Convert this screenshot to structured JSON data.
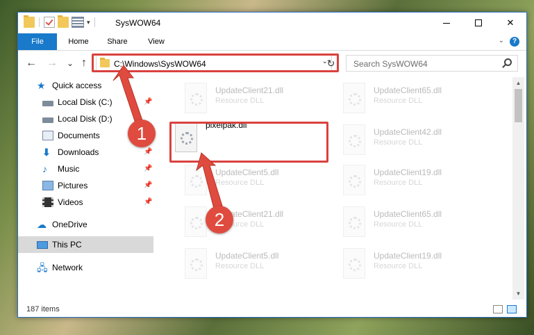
{
  "window": {
    "title": "SysWOW64"
  },
  "ribbon": {
    "tabs": [
      "File",
      "Home",
      "Share",
      "View"
    ],
    "help": "?"
  },
  "nav": {
    "back": "←",
    "forward": "→",
    "recent": "⌄",
    "up": "↑",
    "address": "C:\\Windows\\SysWOW64",
    "refresh": "↻",
    "search_placeholder": "Search SysWOW64"
  },
  "sidebar": {
    "items": [
      {
        "label": "Quick access",
        "icon": "star-icon",
        "pinned": false
      },
      {
        "label": "Local Disk (C:)",
        "icon": "disk-icon",
        "pinned": true
      },
      {
        "label": "Local Disk (D:)",
        "icon": "disk-icon",
        "pinned": false
      },
      {
        "label": "Documents",
        "icon": "documents-icon",
        "pinned": true
      },
      {
        "label": "Downloads",
        "icon": "downloads-icon",
        "pinned": true
      },
      {
        "label": "Music",
        "icon": "music-icon",
        "pinned": true
      },
      {
        "label": "Pictures",
        "icon": "pictures-icon",
        "pinned": true
      },
      {
        "label": "Videos",
        "icon": "videos-icon",
        "pinned": true
      },
      {
        "label": "OneDrive",
        "icon": "cloud-icon",
        "pinned": false
      },
      {
        "label": "This PC",
        "icon": "pc-icon",
        "pinned": false,
        "selected": true
      },
      {
        "label": "Network",
        "icon": "network-icon",
        "pinned": false
      }
    ]
  },
  "files": [
    {
      "name": "UpdateClient21.dll",
      "type": "Resource DLL"
    },
    {
      "name": "UpdateClient65.dll",
      "type": "Resource DLL"
    },
    {
      "name": "pixelpak.dll",
      "type": ""
    },
    {
      "name": "UpdateClient42.dll",
      "type": "Resource DLL"
    },
    {
      "name": "UpdateClient5.dll",
      "type": "Resource DLL"
    },
    {
      "name": "UpdateClient19.dll",
      "type": "Resource DLL"
    },
    {
      "name": "UpdateClient21.dll",
      "type": "Resource DLL"
    },
    {
      "name": "UpdateClient65.dll",
      "type": "Resource DLL"
    },
    {
      "name": "UpdateClient5.dll",
      "type": "Resource DLL"
    },
    {
      "name": "UpdateClient19.dll",
      "type": "Resource DLL"
    }
  ],
  "status": {
    "item_count": "187 items"
  },
  "annotations": {
    "step1": "1",
    "step2": "2",
    "color": "#d9413e"
  }
}
